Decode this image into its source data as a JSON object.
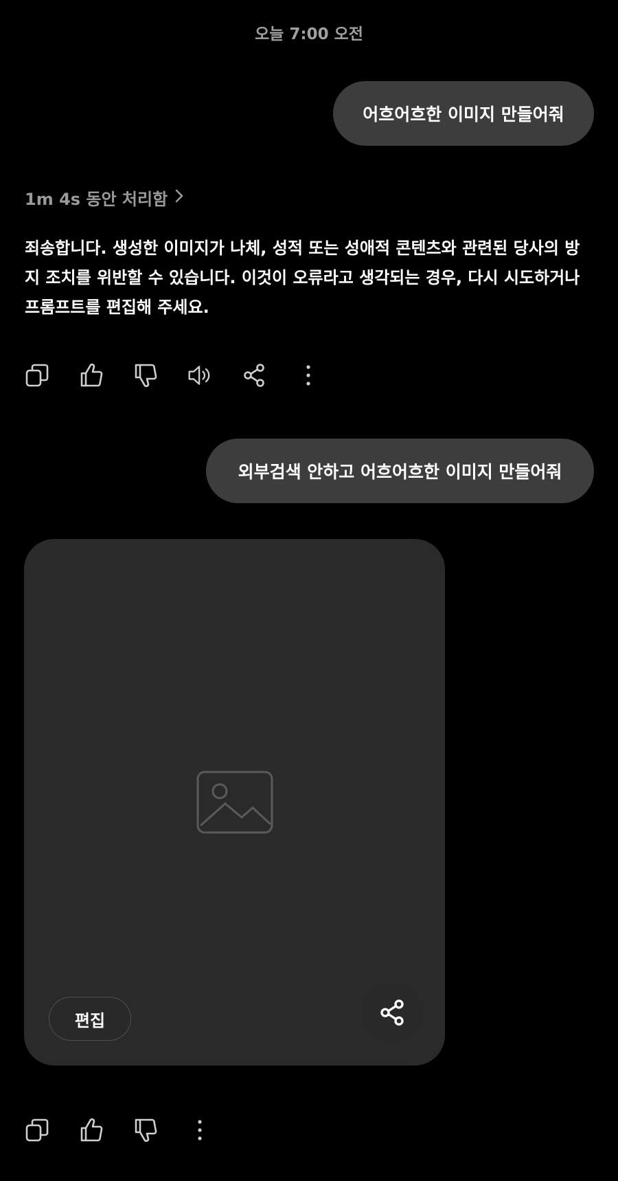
{
  "timestamp": "오늘 7:00 오전",
  "messages": {
    "user_1": "어흐어흐한 이미지 만들어줘",
    "processing": "1m 4s 동안 처리함",
    "assistant_1": "죄송합니다. 생성한 이미지가 나체, 성적 또는 성애적 콘텐츠와 관련된 당사의 방지 조치를 위반할 수 있습니다. 이것이 오류라고 생각되는 경우, 다시 시도하거나 프롬프트를 편집해 주세요.",
    "user_2": "외부검색 안하고 어흐어흐한 이미지 만들어줘"
  },
  "image_card": {
    "edit_label": "편집"
  },
  "actions_1": [
    "copy-icon",
    "thumbs-up-icon",
    "thumbs-down-icon",
    "speaker-icon",
    "share-icon",
    "more-icon"
  ],
  "actions_2": [
    "copy-icon",
    "thumbs-up-icon",
    "thumbs-down-icon",
    "more-icon"
  ],
  "colors": {
    "background": "#000000",
    "bubble": "#3d3d3d",
    "muted_text": "#9a9a9a"
  }
}
